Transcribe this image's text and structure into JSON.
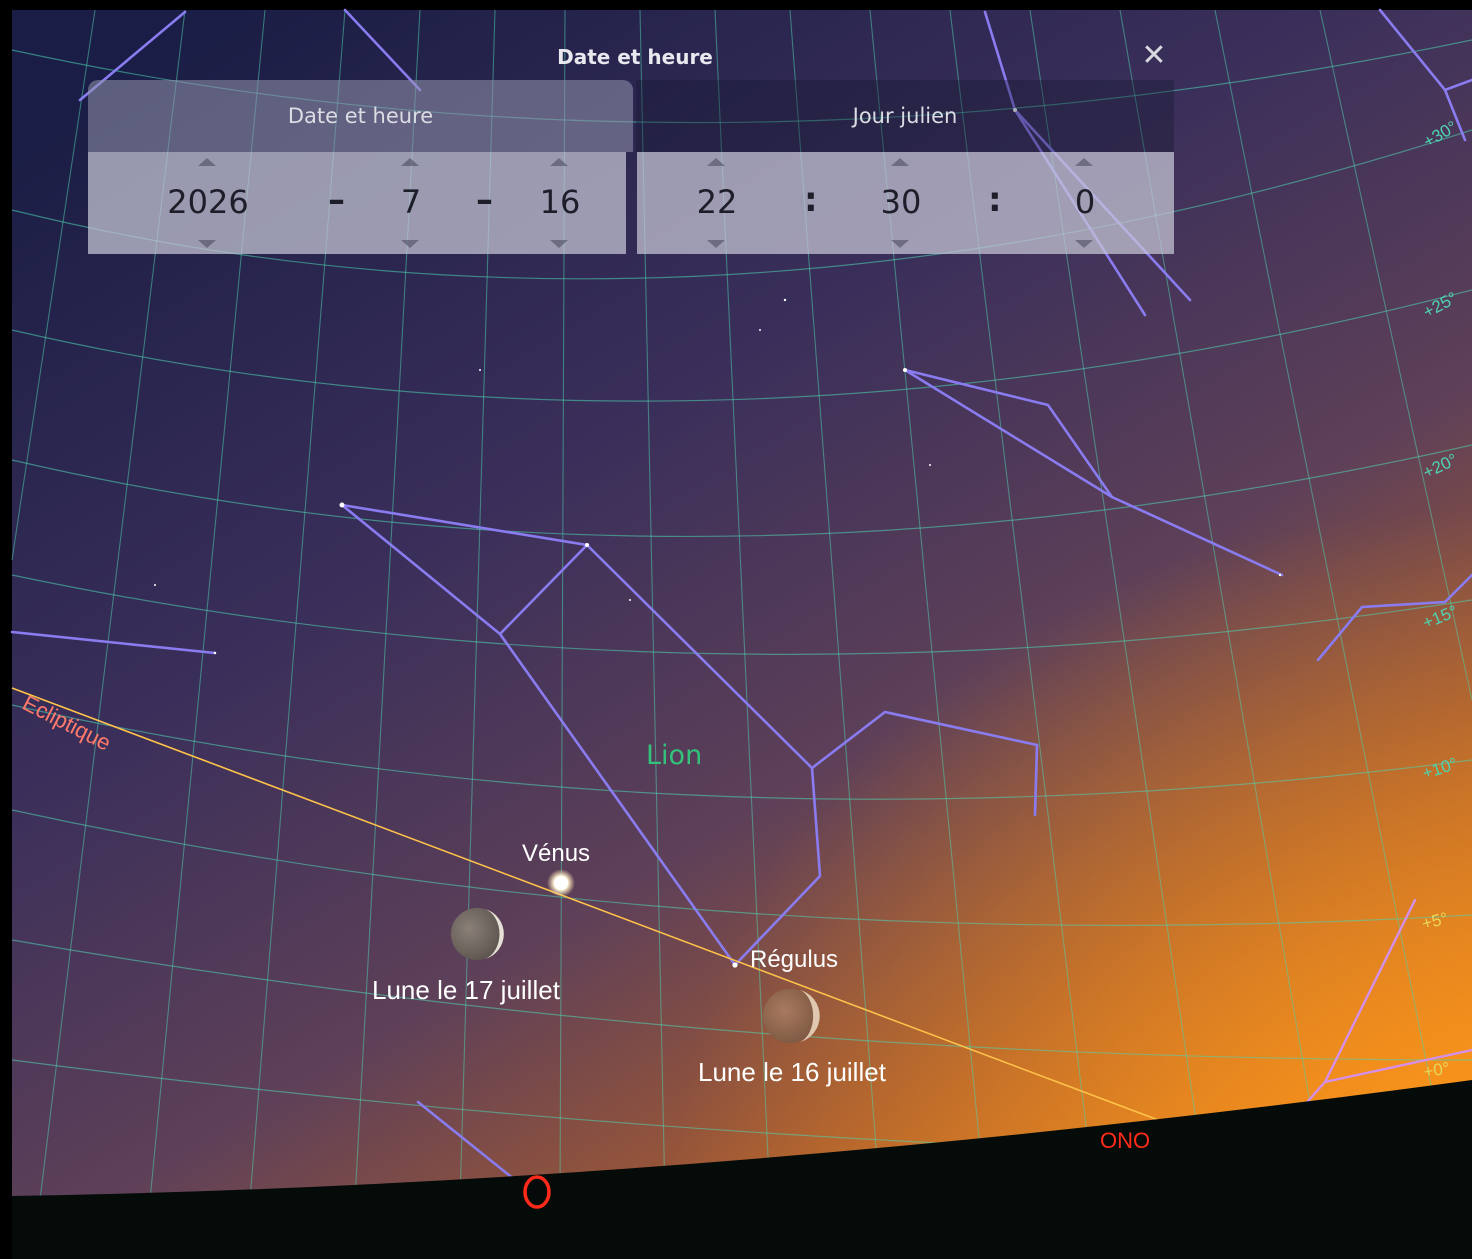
{
  "dialog": {
    "title": "Date et heure",
    "close_symbol": "✕",
    "tabs": [
      {
        "label": "Date et heure",
        "active": true
      },
      {
        "label": "Jour julien",
        "active": false
      }
    ],
    "fields": {
      "year": "2026",
      "month": "7",
      "day": "16",
      "hour": "22",
      "minute": "30",
      "second": "0"
    },
    "date_separator": "–",
    "time_separator": ":"
  },
  "sky": {
    "constellation_name": "Lion",
    "ecliptic_label": "Ecliptique",
    "objects": {
      "venus": "Vénus",
      "regulus": "Régulus",
      "moon_17": "Lune le 17 juillet",
      "moon_16": "Lune le 16 juillet"
    },
    "cardinals": {
      "west": "O",
      "wnw": "ONO"
    },
    "altitude_labels": [
      "+30°",
      "+25°",
      "+20°",
      "+15°",
      "+10°",
      "+5°",
      "+0°"
    ]
  },
  "colors": {
    "constellation_line": "#8a7cf0",
    "grid_line": "#4fd3b0",
    "ecliptic": "#ffc24a",
    "ecliptic_label": "#ff7a6a",
    "lion_label": "#33c27a",
    "cardinal": "#ff2a1a"
  }
}
